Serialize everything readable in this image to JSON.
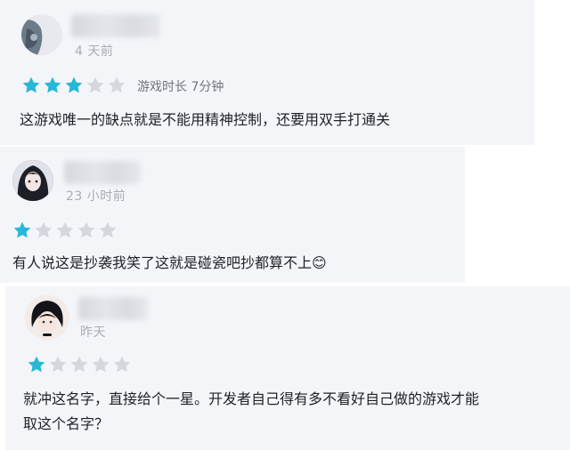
{
  "colors": {
    "star_filled": "#27b8d6",
    "star_empty": "#d5d7dc",
    "card_bg": "#f4f5f9"
  },
  "reviews": [
    {
      "time": "4 天前",
      "rating": 3,
      "max_rating": 5,
      "playtime": "游戏时长 7分钟",
      "text": "这游戏唯一的缺点就是不能用精神控制，还要用双手打通关"
    },
    {
      "time": "23 小时前",
      "rating": 1,
      "max_rating": 5,
      "text": "有人说这是抄袭我笑了这就是碰瓷吧抄都算不上😊"
    },
    {
      "time": "昨天",
      "rating": 1,
      "max_rating": 5,
      "text_line1": "就冲这名字，直接给个一星。开发者自己得有多不看好自己做的游戏才能",
      "text_line2": "取这个名字？"
    }
  ]
}
